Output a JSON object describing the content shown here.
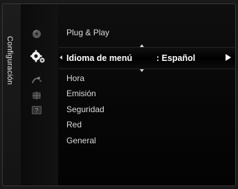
{
  "sidebar": {
    "title": "Configuración"
  },
  "menu": {
    "items": [
      {
        "label": "Plug & Play"
      },
      {
        "label": "Idioma de menú",
        "value": ": Español",
        "selected": true
      },
      {
        "label": "Hora"
      },
      {
        "label": "Emisión"
      },
      {
        "label": "Seguridad"
      },
      {
        "label": "Red"
      },
      {
        "label": "General"
      }
    ]
  },
  "icons": {
    "plug_play": "disc-icon",
    "language": "gear-icon",
    "time": "satellite-icon",
    "broadcast": "antenna-icon",
    "security": "help-icon"
  },
  "colors": {
    "background": "#060606",
    "text": "#dcdcdc",
    "selected_text": "#ffffff"
  }
}
